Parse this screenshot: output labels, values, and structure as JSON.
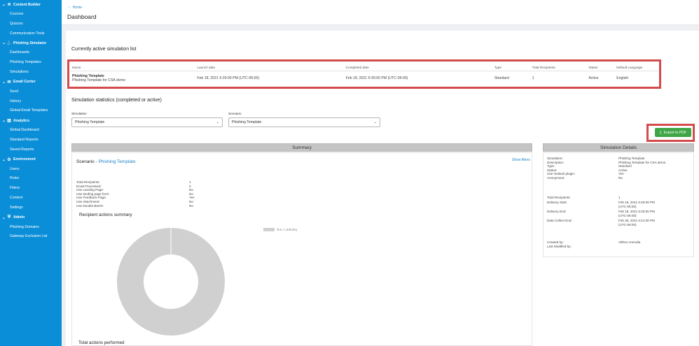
{
  "sidebar": {
    "sections": [
      {
        "label": "Content Builder",
        "icon": "layers-icon",
        "glyph": "≋",
        "items": [
          "Courses",
          "Quizzes",
          "Communication Tools"
        ]
      },
      {
        "label": "Phishing Simulator",
        "icon": "fishhook-icon",
        "glyph": "⚓",
        "items": [
          "Dashboards",
          "Phishing Templates",
          "Simulations"
        ]
      },
      {
        "label": "Email Center",
        "icon": "envelope-icon",
        "glyph": "✉",
        "items": [
          "Send",
          "History",
          "Global Email Templates"
        ]
      },
      {
        "label": "Analytics",
        "icon": "chart-icon",
        "glyph": "▥",
        "items": [
          "Global Dashboard",
          "Standard Reports",
          "Saved Reports"
        ]
      },
      {
        "label": "Environment",
        "icon": "gear-icon",
        "glyph": "⚙",
        "items": [
          "Users",
          "Roles",
          "Filters",
          "Content",
          "Settings"
        ]
      },
      {
        "label": "Admin",
        "icon": "shield-icon",
        "glyph": "⛨",
        "items": [
          "Phishing Domains",
          "Gateway Exclusion List"
        ]
      }
    ]
  },
  "header": {
    "breadcrumb": "Home",
    "title": "Dashboard"
  },
  "active_list": {
    "title": "Currently active simulation list",
    "columns": [
      "Name",
      "Launch date",
      "Completed date",
      "Type",
      "Total Recipients",
      "Status",
      "Default Language"
    ],
    "rows": [
      {
        "name": "Phishing Template",
        "subname": "Phishing Template for CSA demo",
        "launch": "Feb 18, 2021 6:29:00 PM (UTC-06:00)",
        "completed": "Feb 18, 2021 6:30:00 PM (UTC-06:00)",
        "type": "Standard",
        "recipients": "1",
        "status": "Active",
        "language": "English"
      }
    ]
  },
  "stats": {
    "title": "Simulation statistics (completed or active)",
    "simulation_label": "Simulation",
    "simulation_value": "Phishing Template",
    "scenario_label": "Scenario",
    "scenario_value": "Phishing Template",
    "export_label": "Export to PDF"
  },
  "summary": {
    "bar_title": "Summary",
    "scenario_prefix": "Scenario -",
    "scenario_link": "Phishing Template",
    "show_filters": "Show filters",
    "rows": [
      {
        "label": "Total Recipients:",
        "value": "1"
      },
      {
        "label": "Email Processed:",
        "value": "0"
      },
      {
        "label": "Use Landing Page:",
        "value": "No"
      },
      {
        "label": "Use landing page form:",
        "value": "No"
      },
      {
        "label": "Use Feedback Page:",
        "value": "Yes"
      },
      {
        "label": "Use Attachment:",
        "value": "No"
      },
      {
        "label": "Use Double Barrel:",
        "value": "No"
      }
    ],
    "recipient_actions_title": "Recipient actions summary",
    "legend": "N/A: 1 (100.0%)",
    "total_actions_title": "Total actions performed"
  },
  "details": {
    "bar_title": "Simulation Details",
    "rows": [
      {
        "label": "Simulation:",
        "value": "Phishing Template"
      },
      {
        "label": "Description:",
        "value": "Phishing Template for CSA demo"
      },
      {
        "label": "Type:",
        "value": "Standard"
      },
      {
        "label": "Status:",
        "value": "Active"
      },
      {
        "label": "Use Outlook plugin:",
        "value": "Yes"
      },
      {
        "label": "Anonymous:",
        "value": "No"
      }
    ],
    "timing": [
      {
        "label": "Total Recipients:",
        "value1": "1",
        "value2": ""
      },
      {
        "label": "Delivery Start:",
        "value1": "Feb 18, 2021 6:29:00 PM",
        "value2": "(UTC-06:00)"
      },
      {
        "label": "Delivery End:",
        "value1": "Feb 18, 2021 6:30:00 PM",
        "value2": "(UTC-06:00)"
      },
      {
        "label": "Data Collect End:",
        "value1": "Feb 25, 2021 6:21:00 PM",
        "value2": "(UTC-06:00)"
      }
    ],
    "created_by_label": "Created by:",
    "created_by_value": "Vibhor Amrodia",
    "modified_by_label": "Last Modified by:",
    "modified_by_value": ""
  },
  "chart_data": {
    "type": "pie",
    "categories": [
      "N/A"
    ],
    "values": [
      1
    ],
    "colors": [
      "#d0d0d0"
    ]
  }
}
